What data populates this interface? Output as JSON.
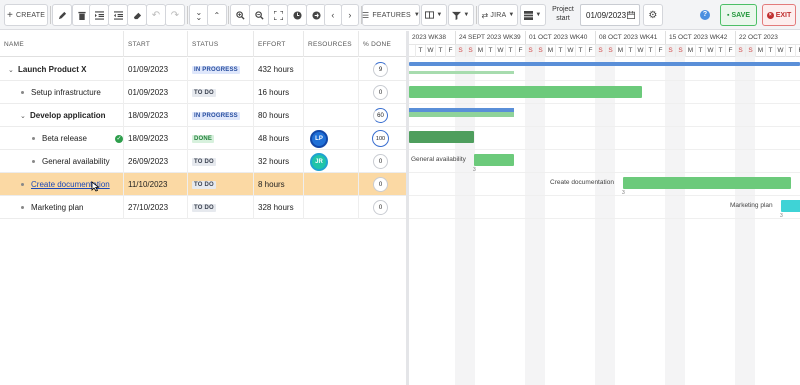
{
  "toolbar": {
    "create_label": "CREATE",
    "features_label": "FEATURES",
    "jira_label": "JIRA",
    "project_start_label": "Project start",
    "project_start_value": "01/09/2023",
    "save_label": "SAVE",
    "exit_label": "EXIT",
    "help_label": "?"
  },
  "grid": {
    "columns": [
      "NAME",
      "START",
      "STATUS",
      "EFFORT",
      "RESOURCES",
      "% DONE"
    ],
    "rows": [
      {
        "name": "Launch Product X",
        "start": "01/09/2023",
        "status": "IN PROGRESS",
        "effort": "432 hours",
        "resources": "",
        "done": "9"
      },
      {
        "name": "Setup infrastructure",
        "start": "01/09/2023",
        "status": "TO DO",
        "effort": "16 hours",
        "resources": "",
        "done": "0"
      },
      {
        "name": "Develop application",
        "start": "18/09/2023",
        "status": "IN PROGRESS",
        "effort": "80 hours",
        "resources": "",
        "done": "60"
      },
      {
        "name": "Beta release",
        "start": "18/09/2023",
        "status": "DONE",
        "effort": "48 hours",
        "resources": "LP",
        "done": "100"
      },
      {
        "name": "General availability",
        "start": "26/09/2023",
        "status": "TO DO",
        "effort": "32 hours",
        "resources": "JR",
        "done": "0"
      },
      {
        "name": "Create documentation",
        "start": "11/10/2023",
        "status": "TO DO",
        "effort": "8 hours",
        "resources": "",
        "done": "0"
      },
      {
        "name": "Marketing plan",
        "start": "27/10/2023",
        "status": "TO DO",
        "effort": "328 hours",
        "resources": "",
        "done": "0"
      }
    ]
  },
  "timeline": {
    "weeks": [
      "2023 WK38",
      "24 SEPT 2023 WK39",
      "01 OCT 2023 WK40",
      "08 OCT 2023 WK41",
      "15 OCT 2023 WK42",
      "22 OCT 2023"
    ],
    "days": [
      "T",
      "W",
      "T",
      "F",
      "S",
      "S",
      "M",
      "T",
      "W",
      "T",
      "F",
      "S",
      "S",
      "M",
      "T",
      "W",
      "T",
      "F",
      "S",
      "S",
      "M",
      "T",
      "W",
      "T",
      "F",
      "S",
      "S",
      "M",
      "T",
      "W",
      "T",
      "F",
      "S",
      "S",
      "M",
      "T",
      "W",
      "T",
      "F",
      "S",
      "S",
      "M",
      "T",
      "W"
    ],
    "labels": {
      "general_availability": "General availability",
      "create_documentation": "Create documentation",
      "marketing_plan": "Marketing plan"
    },
    "dep_marker": "3"
  },
  "colors": {
    "summary_bar": "#5a8fd8",
    "task_bar": "#6cca7b",
    "done_bar": "#4e9e5d",
    "marketing_bar": "#3fd3d6",
    "selected_row": "#fbd9a4",
    "avatar_lp": "#1f6fd6",
    "avatar_jr": "#20c4a8"
  }
}
